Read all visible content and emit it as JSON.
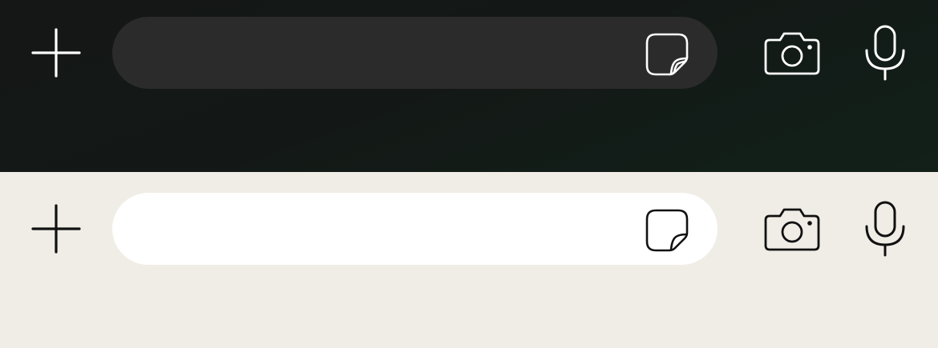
{
  "variants": [
    {
      "theme": "dark",
      "icons": [
        "plus-icon",
        "sticker-icon",
        "camera-icon",
        "microphone-icon"
      ],
      "colors": {
        "background": "#141816",
        "input_background": "#2b2b2b",
        "icon": "#ffffff"
      },
      "message_input": {
        "value": "",
        "placeholder": ""
      }
    },
    {
      "theme": "light",
      "icons": [
        "plus-icon",
        "sticker-icon",
        "camera-icon",
        "microphone-icon"
      ],
      "colors": {
        "background": "#f0ede6",
        "input_background": "#ffffff",
        "icon": "#111111"
      },
      "message_input": {
        "value": "",
        "placeholder": ""
      }
    }
  ]
}
